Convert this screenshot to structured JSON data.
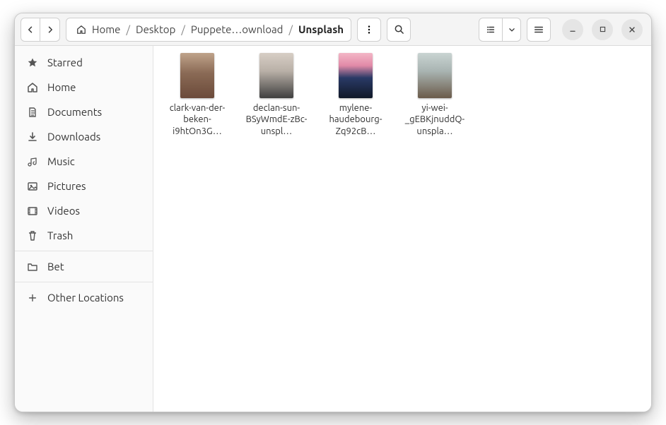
{
  "breadcrumb": {
    "home": "Home",
    "desktop": "Desktop",
    "puppeteer": "Puppete…ownload",
    "current": "Unsplash"
  },
  "sidebar": {
    "starred": "Starred",
    "home": "Home",
    "documents": "Documents",
    "downloads": "Downloads",
    "music": "Music",
    "pictures": "Pictures",
    "videos": "Videos",
    "trash": "Trash",
    "bet": "Bet",
    "other": "Other Locations"
  },
  "files": {
    "f0": "clark-van-der-beken-i9htOn3G…",
    "f1": "declan-sun-BSyWmdE-zBc-unspl…",
    "f2": "mylene-haudebourg-Zq92cB…",
    "f3": "yi-wei-_gEBKjnuddQ-unspla…"
  },
  "thumbnails": {
    "f0": {
      "style": "background: linear-gradient(180deg,#bfa38a 0%,#8a6a55 45%,#6b4a3a 100%);"
    },
    "f1": {
      "style": "background: linear-gradient(180deg,#d7cec5 0%,#b9b0a7 40%,#3f3f3f 100%);"
    },
    "f2": {
      "style": "background: linear-gradient(180deg,#f3b6c6 0%,#e28aa8 28%,#2a3a66 55%,#101828 100%);"
    },
    "f3": {
      "style": "background: linear-gradient(180deg,#c9d4d2 0%,#a9b4b2 40%,#6b5b4a 100%);"
    }
  }
}
